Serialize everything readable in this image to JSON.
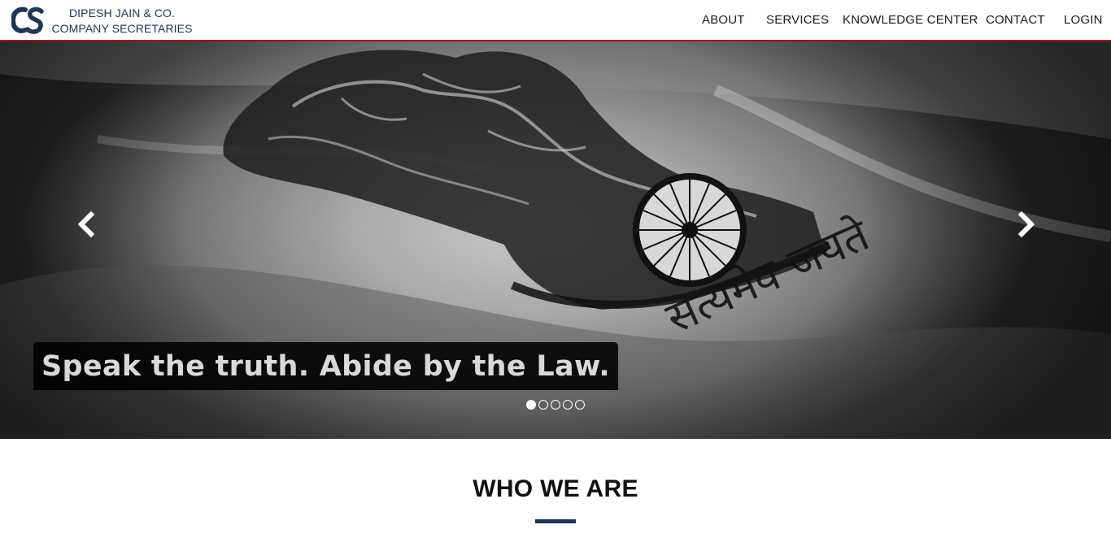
{
  "brand": {
    "logo_text": "CS",
    "line1": "DIPESH JAIN & CO.",
    "line2": "COMPANY SECRETARIES"
  },
  "nav": {
    "items": [
      {
        "label": "ABOUT"
      },
      {
        "label": "SERVICES"
      },
      {
        "label": "KNOWLEDGE CENTER"
      },
      {
        "label": "CONTACT"
      },
      {
        "label": "LOGIN"
      }
    ]
  },
  "hero": {
    "image_inscription": "सत्यमेव जयते",
    "caption": "Speak the truth. Abide by the Law.",
    "slide_count": 5,
    "active_slide": 1,
    "prev_icon": "chevron-left-icon",
    "next_icon": "chevron-right-icon"
  },
  "section": {
    "title": "WHO WE ARE"
  },
  "colors": {
    "brand_navy": "#1d3557",
    "header_rule": "#9b1b1b",
    "caption_bg": "#000000"
  }
}
